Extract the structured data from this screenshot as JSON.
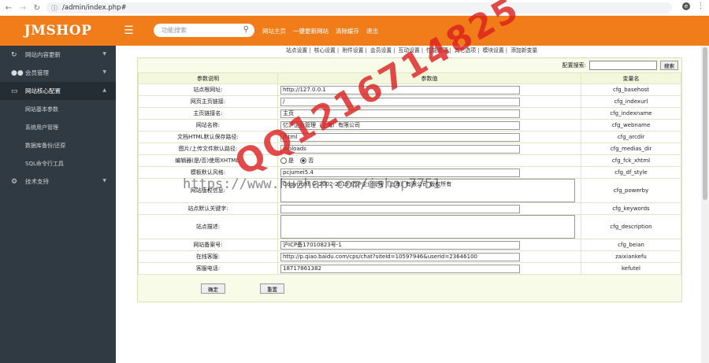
{
  "browser": {
    "url": "/admin/index.php#",
    "avatar_letter": "e"
  },
  "header": {
    "logo": "JMSHOP",
    "search_placeholder": "功能搜索",
    "links": [
      "网站主页",
      "一键更新网站",
      "清除缓存",
      "退出"
    ]
  },
  "sidebar": {
    "items": [
      {
        "label": "网站内容更新",
        "icon": "refresh-icon"
      },
      {
        "label": "会员管理",
        "icon": "users-icon"
      },
      {
        "label": "网站核心配置",
        "icon": "monitor-icon"
      }
    ],
    "sub_items": [
      "网站基本参数",
      "系统用户管理",
      "数据库备份/还原",
      "SQL命令行工具"
    ],
    "last_item": {
      "label": "技术支持",
      "icon": "gears-icon"
    }
  },
  "tabs": [
    "站点设置",
    "核心设置",
    "附件设置",
    "会员设置",
    "互动设置",
    "性能选项",
    "其它选项",
    "模块设置",
    "添加新变量"
  ],
  "config_search": {
    "label": "配置搜索:",
    "button": "搜索"
  },
  "table": {
    "headers": [
      "参数说明",
      "参数值",
      "变量名"
    ],
    "rows": [
      {
        "label": "站点根网址:",
        "value": "http://127.0.0.1",
        "var": "cfg_basehost"
      },
      {
        "label": "网页主页链接:",
        "value": "/",
        "var": "cfg_indexurl"
      },
      {
        "label": "主页链接名:",
        "value": "主页",
        "var": "cfg_indexname"
      },
      {
        "label": "网站名称:",
        "value": "亿沪企业管理（上海）有限公司",
        "var": "cfg_webname"
      },
      {
        "label": "文档HTML默认保存路径:",
        "value": "/html",
        "var": "cfg_arcdir"
      },
      {
        "label": "图片/上传文件默认路径:",
        "value": "/uploads",
        "var": "cfg_medias_dir"
      },
      {
        "label": "编辑器(是/否)使用XHTML:",
        "radio": [
          "是",
          "否"
        ],
        "var": "cfg_fck_xhtml"
      },
      {
        "label": "模板默认风格:",
        "value": "pcjumei5.4",
        "var": "cfg_df_style"
      },
      {
        "label": "网站版权信息:",
        "value": "Copyright © 2002-2019 亿沪企业管理（上海）有限公司 版权所有",
        "var": "cfg_powerby",
        "textarea": true
      },
      {
        "label": "站点默认关键字:",
        "value": "",
        "var": "cfg_keywords"
      },
      {
        "label": "站点描述:",
        "value": "",
        "var": "cfg_description",
        "textarea": true
      },
      {
        "label": "网站备案号:",
        "value": "沪ICP备17010823号-1",
        "var": "cfg_beian"
      },
      {
        "label": "在线客服:",
        "value": "http://p.qiao.baidu.com/cps/chat?siteId=10597946&userId=23646100",
        "var": "zaixiankefu"
      },
      {
        "label": "客服电话:",
        "value": "18717861382",
        "var": "kefutel"
      }
    ]
  },
  "buttons": {
    "confirm": "确定",
    "reset": "重置"
  },
  "watermark": {
    "number": "QQ1216714825",
    "url": "https://www.huzhan.com/ishop7751"
  }
}
